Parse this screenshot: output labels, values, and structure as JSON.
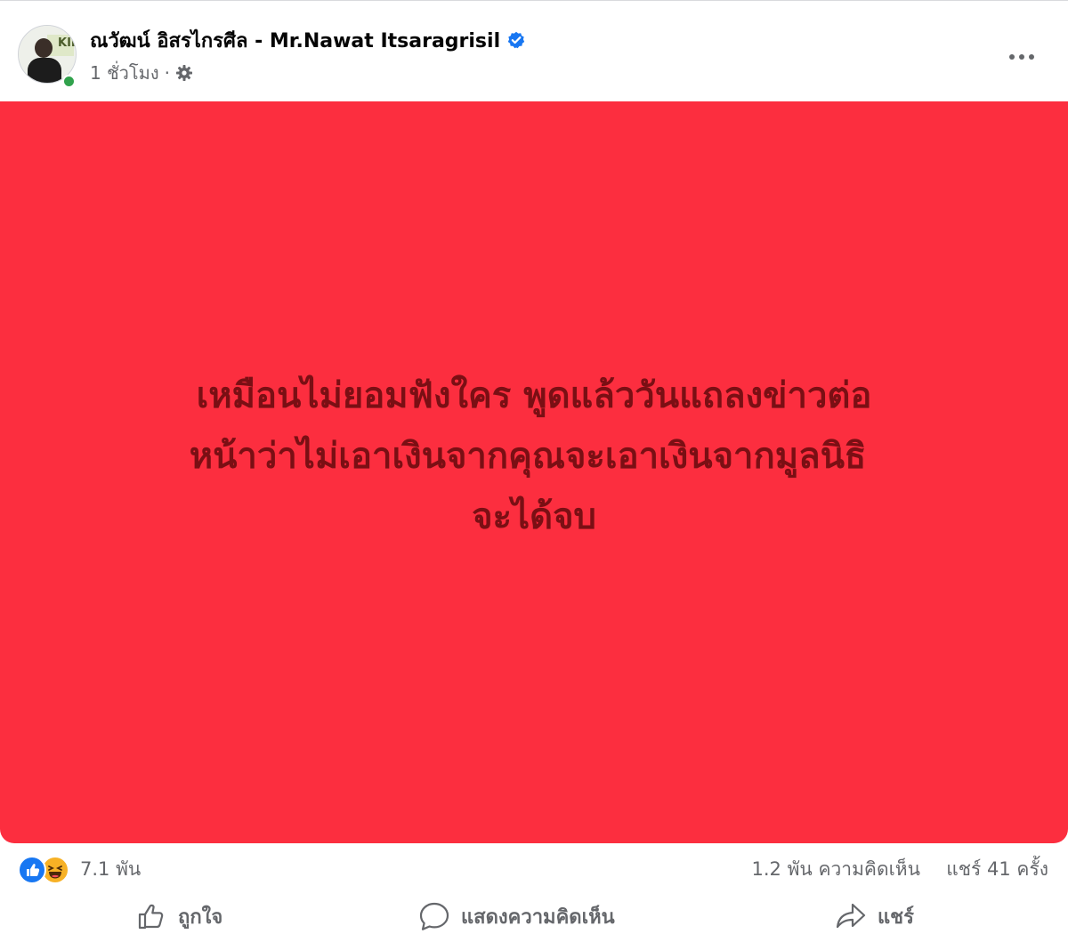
{
  "post": {
    "author_name": "ณวัฒน์ อิสรไกรศีล - Mr.Nawat Itsaragrisil",
    "avatar_sign_text": "KII",
    "time": "1 ชั่วโมง",
    "meta_separator": "·",
    "verified": true,
    "background_color": "#fc2e3f",
    "text_color": "#7a0f14",
    "text_lines": [
      "เหมือนไม่ยอมฟังใคร พูดแล้ววันแถลงข่าวต่อ",
      "หน้าว่าไม่เอาเงินจากคุณจะเอาเงินจากมูลนิธิ ￼",
      "จะได้จบ"
    ]
  },
  "stats": {
    "reactions": [
      "like",
      "haha"
    ],
    "reaction_count": "7.1 พัน",
    "comment_count": "1.2 พัน ความคิดเห็น",
    "share_count": "แชร์ 41 ครั้ง"
  },
  "actions": {
    "like_label": "ถูกใจ",
    "comment_label": "แสดงความคิดเห็น",
    "share_label": "แชร์"
  },
  "colors": {
    "accent": "#1877f2",
    "secondary_text": "#65676b",
    "online": "#31a24c"
  }
}
